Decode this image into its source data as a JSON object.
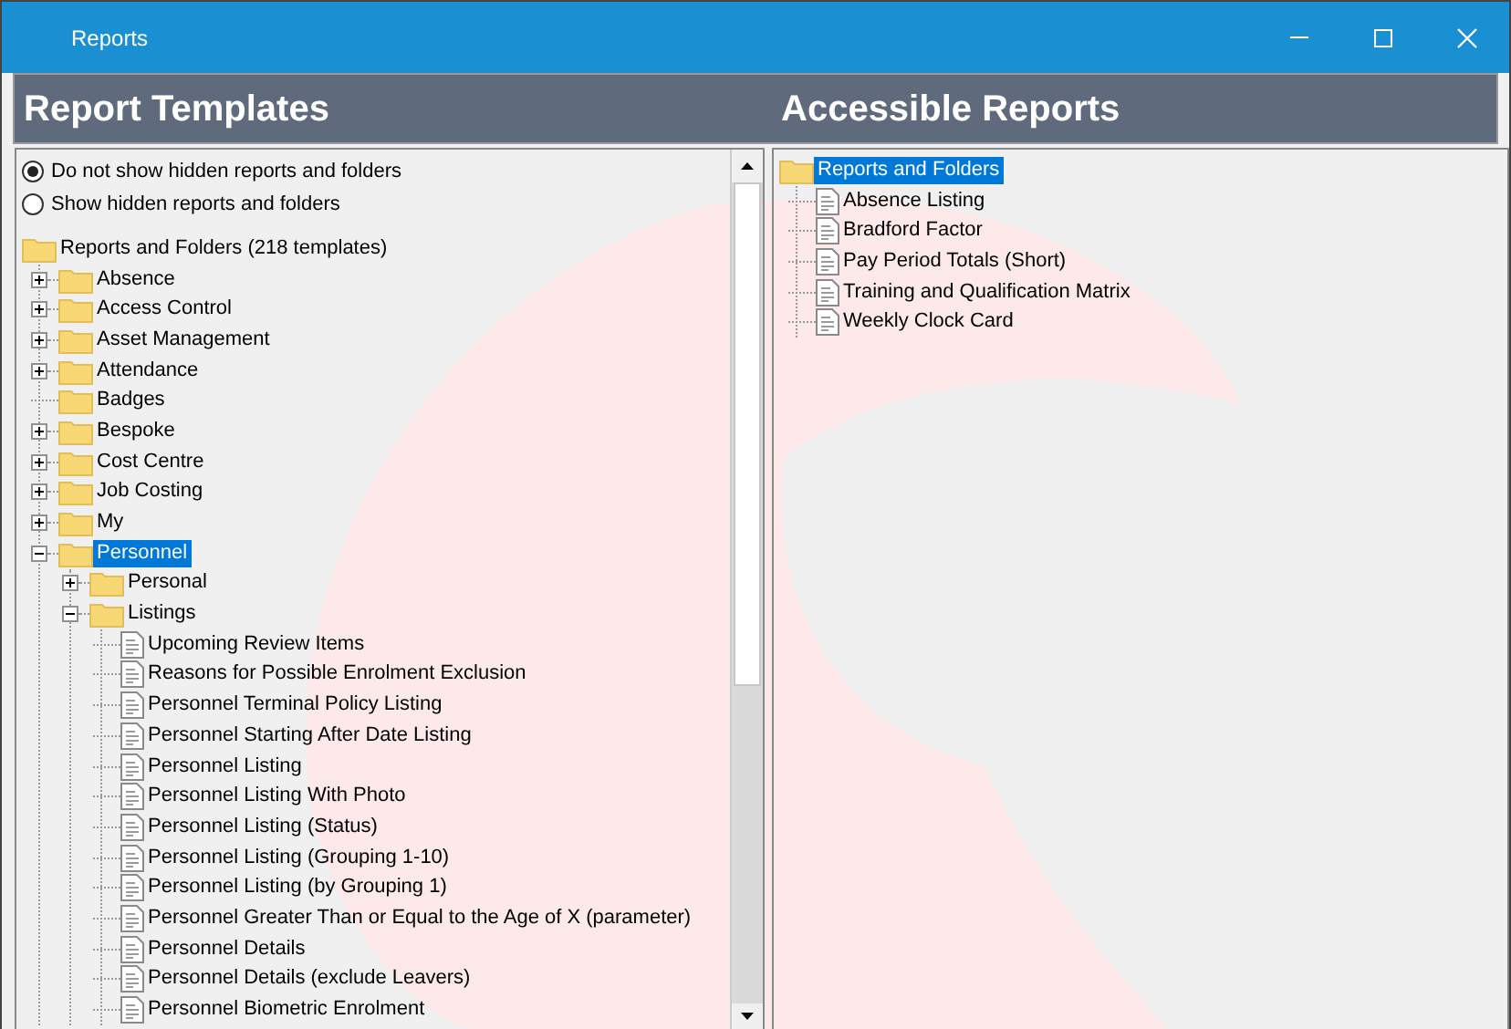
{
  "window": {
    "title": "Reports"
  },
  "headers": {
    "left": "Report Templates",
    "right": "Accessible Reports"
  },
  "visibility_options": [
    {
      "label": "Do not show hidden reports and folders",
      "selected": true
    },
    {
      "label": "Show hidden reports and folders",
      "selected": false
    }
  ],
  "template_tree": {
    "label": "Reports and Folders (218 templates)",
    "kind": "folder",
    "selected": false,
    "children": [
      {
        "label": "Absence",
        "kind": "folder",
        "expanded": false,
        "selected": false
      },
      {
        "label": "Access Control",
        "kind": "folder",
        "expanded": false,
        "selected": false
      },
      {
        "label": "Asset Management",
        "kind": "folder",
        "expanded": false,
        "selected": false
      },
      {
        "label": "Attendance",
        "kind": "folder",
        "expanded": false,
        "selected": false
      },
      {
        "label": "Badges",
        "kind": "folder",
        "selected": false
      },
      {
        "label": "Bespoke",
        "kind": "folder",
        "expanded": false,
        "selected": false
      },
      {
        "label": "Cost Centre",
        "kind": "folder",
        "expanded": false,
        "selected": false
      },
      {
        "label": "Job Costing",
        "kind": "folder",
        "expanded": false,
        "selected": false
      },
      {
        "label": "My",
        "kind": "folder",
        "expanded": false,
        "selected": false
      },
      {
        "label": "Personnel",
        "kind": "folder",
        "expanded": true,
        "selected": true,
        "children": [
          {
            "label": "Personal",
            "kind": "folder",
            "expanded": false,
            "selected": false
          },
          {
            "label": "Listings",
            "kind": "folder",
            "expanded": true,
            "selected": false,
            "children": [
              {
                "label": "Upcoming Review Items",
                "kind": "report",
                "selected": false
              },
              {
                "label": "Reasons for Possible Enrolment Exclusion",
                "kind": "report",
                "selected": false
              },
              {
                "label": "Personnel Terminal Policy Listing",
                "kind": "report",
                "selected": false
              },
              {
                "label": "Personnel Starting After Date Listing",
                "kind": "report",
                "selected": false
              },
              {
                "label": "Personnel Listing",
                "kind": "report",
                "selected": false
              },
              {
                "label": "Personnel Listing With Photo",
                "kind": "report",
                "selected": false
              },
              {
                "label": "Personnel Listing (Status)",
                "kind": "report",
                "selected": false
              },
              {
                "label": "Personnel Listing (Grouping 1-10)",
                "kind": "report",
                "selected": false
              },
              {
                "label": "Personnel Listing (by Grouping 1)",
                "kind": "report",
                "selected": false
              },
              {
                "label": "Personnel Greater Than or Equal to the Age of X (parameter)",
                "kind": "report",
                "selected": false
              },
              {
                "label": "Personnel Details",
                "kind": "report",
                "selected": false
              },
              {
                "label": "Personnel Details (exclude Leavers)",
                "kind": "report",
                "selected": false
              },
              {
                "label": "Personnel Biometric Enrolment",
                "kind": "report",
                "selected": false
              }
            ]
          }
        ]
      }
    ]
  },
  "accessible_tree": {
    "label": "Reports and Folders",
    "kind": "folder",
    "selected": true,
    "children": [
      {
        "label": "Absence Listing",
        "kind": "report",
        "selected": false
      },
      {
        "label": "Bradford Factor",
        "kind": "report",
        "selected": false
      },
      {
        "label": "Pay Period Totals (Short)",
        "kind": "report",
        "selected": false
      },
      {
        "label": "Training and Qualification Matrix",
        "kind": "report",
        "selected": false
      },
      {
        "label": "Weekly Clock Card",
        "kind": "report",
        "selected": false
      }
    ]
  }
}
